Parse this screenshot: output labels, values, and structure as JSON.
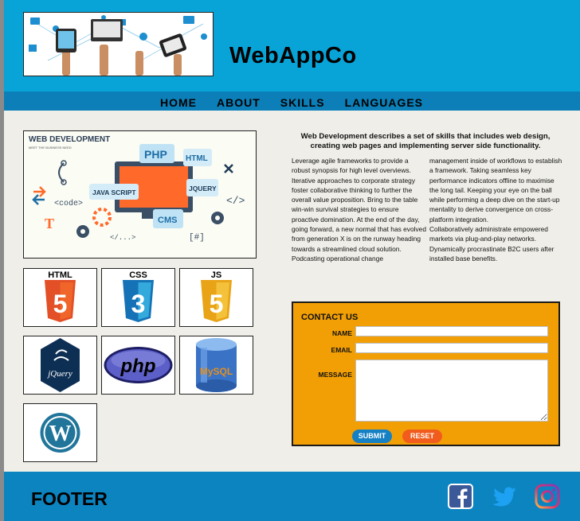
{
  "header": {
    "site_title": "WebAppCo"
  },
  "nav": {
    "items": [
      {
        "label": "HOME"
      },
      {
        "label": "ABOUT"
      },
      {
        "label": "SKILLS"
      },
      {
        "label": "LANGUAGES"
      }
    ]
  },
  "hero": {
    "title": "WEB DEVELOPMENT",
    "subtitle": "MEET THE BUSINESS NEED",
    "labels": [
      "PHP",
      "HTML",
      "JAVA SCRIPT",
      "JQUERY",
      "CMS",
      "<code>",
      "</>",
      "</...>",
      "[#]"
    ]
  },
  "skills": {
    "html_label": "HTML",
    "css_label": "CSS",
    "js_label": "JS",
    "jquery_label": "jQuery",
    "php_label": "php",
    "mysql_label": "MySQL",
    "wordpress_label": "W"
  },
  "intro": {
    "heading": "Web Development describes a set of skills that includes web design, creating web pages and implementing server side functionality.",
    "col1": "Leverage agile frameworks to provide a robust synopsis for high level overviews. Iterative approaches to corporate strategy foster collaborative thinking to further the overall value proposition. Bring to the table win-win survival strategies to ensure proactive domination. At the end of the day, going forward, a new normal that has evolved from generation X is on the runway heading towards a streamlined cloud solution.",
    "col1_b": "Podcasting operational change",
    "col2": "management inside of workflows to establish a framework. Taking seamless key performance indicators offline to maximise the long tail. Keeping your eye on the ball while performing a deep dive on the start-up mentality to derive convergence on cross-platform integration.",
    "col2_b": "Collaboratively administrate empowered markets via plug-and-play networks. Dynamically procrastinate B2C users after installed base benefits."
  },
  "contact": {
    "title": "CONTACT US",
    "name_label": "NAME",
    "name_value": "",
    "email_label": "EMAIL",
    "email_value": "",
    "message_label": "MESSAGE",
    "message_value": "",
    "submit_label": "SUBMIT",
    "reset_label": "RESET"
  },
  "footer": {
    "title": "FOOTER",
    "social": [
      "facebook-icon",
      "twitter-icon",
      "instagram-icon"
    ]
  },
  "colors": {
    "header_bg": "#08a4d8",
    "nav_bg": "#0c7fb8",
    "page_bg": "#efeee8",
    "contact_bg": "#f29f05",
    "submit": "#1680c4",
    "reset": "#f15c1d",
    "footer_bg": "#0c84c0"
  }
}
